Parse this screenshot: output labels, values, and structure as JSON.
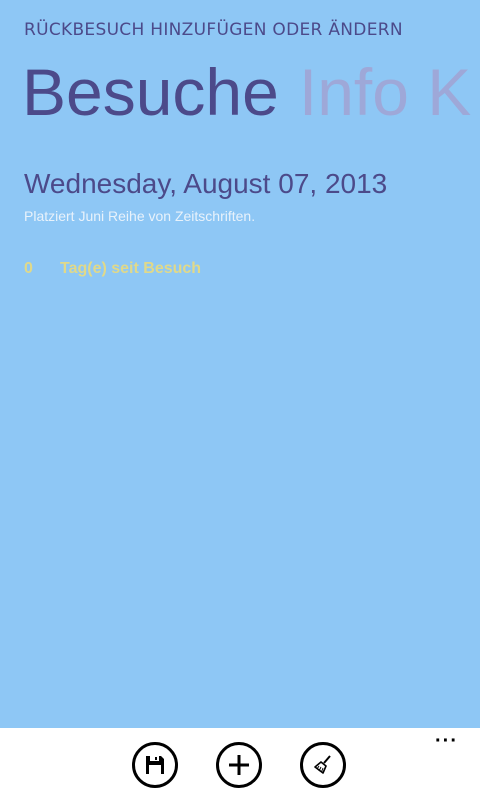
{
  "header": {
    "app_title": "RÜCKBESUCH HINZUFÜGEN ODER ÄNDERN"
  },
  "pivot": {
    "items": [
      {
        "label": "Besuche",
        "active": true
      },
      {
        "label": "Info K",
        "active": false
      }
    ]
  },
  "visit": {
    "date": "Wednesday, August 07, 2013",
    "note": "Platziert Juni Reihe von Zeitschriften.",
    "days_count": "0",
    "days_label": "Tag(e) seit Besuch"
  },
  "app_bar": {
    "buttons": [
      {
        "icon": "save-icon"
      },
      {
        "icon": "add-icon"
      },
      {
        "icon": "clear-icon"
      }
    ],
    "more": "···"
  },
  "colors": {
    "background": "#8ec7f5",
    "accent": "#4c4a8a",
    "inactive_pivot": "#9ea8d8",
    "days_text": "#e0d98a"
  }
}
